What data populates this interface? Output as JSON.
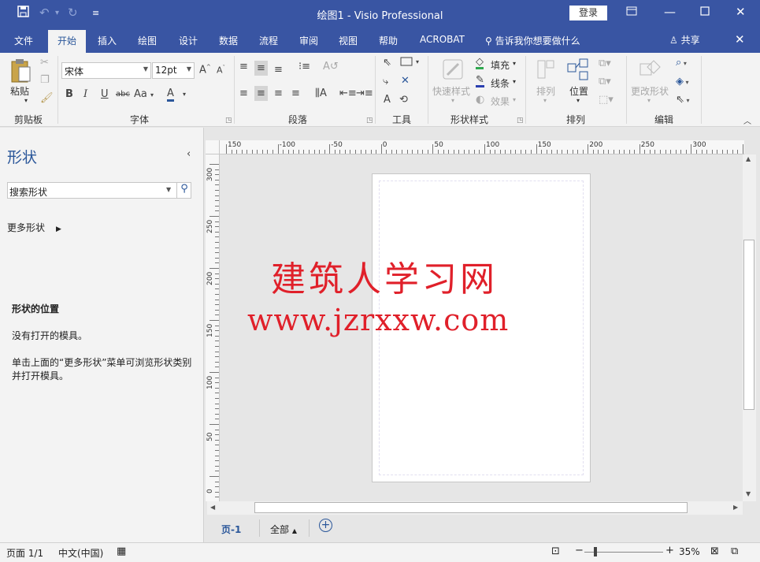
{
  "titlebar": {
    "title": "绘图1  -  Visio Professional",
    "login": "登录",
    "icons": [
      "save-icon",
      "undo-icon",
      "redo-icon",
      "customize-icon",
      "ribbon-display-icon",
      "minimize-icon",
      "maximize-icon",
      "close-icon"
    ]
  },
  "tabs": [
    "文件",
    "开始",
    "插入",
    "绘图",
    "设计",
    "数据",
    "流程",
    "审阅",
    "视图",
    "帮助",
    "ACROBAT"
  ],
  "tellme": "告诉我你想要做什么",
  "share": "共享",
  "ribbon": {
    "clipboard": {
      "paste": "粘贴",
      "label": "剪贴板"
    },
    "font": {
      "name": "宋体",
      "size": "12pt",
      "label": "字体"
    },
    "paragraph": {
      "label": "段落"
    },
    "tools": {
      "label": "工具"
    },
    "shape_style": {
      "quick": "快速样式",
      "fill": "填充",
      "line": "线条",
      "effect": "效果",
      "label": "形状样式"
    },
    "arrange": {
      "arrange": "排列",
      "position": "位置",
      "label": "排列"
    },
    "edit": {
      "change_shape": "更改形状",
      "label": "编辑"
    }
  },
  "shapes_panel": {
    "title": "形状",
    "search_placeholder": "搜索形状",
    "more": "更多形状",
    "position_heading": "形状的位置",
    "no_stencil": "没有打开的模具。",
    "hint_line1": "单击上面的“更多形状”菜单可浏览形状类别",
    "hint_line2": "并打开模具。"
  },
  "rulers": {
    "h": [
      "150",
      "-100",
      "-50",
      "0",
      "50",
      "100",
      "150",
      "200",
      "250",
      "300",
      "3"
    ],
    "v": [
      "300",
      "250",
      "200",
      "150",
      "100",
      "50",
      "0"
    ]
  },
  "watermark": {
    "line1": "建筑人学习网",
    "line2": "www.jzrxxw.com"
  },
  "page_tabs": {
    "current": "页-1",
    "all": "全部"
  },
  "status": {
    "page": "页面 1/1",
    "lang": "中文(中国)",
    "zoom": "35%",
    "zoom_level": 0.35
  }
}
